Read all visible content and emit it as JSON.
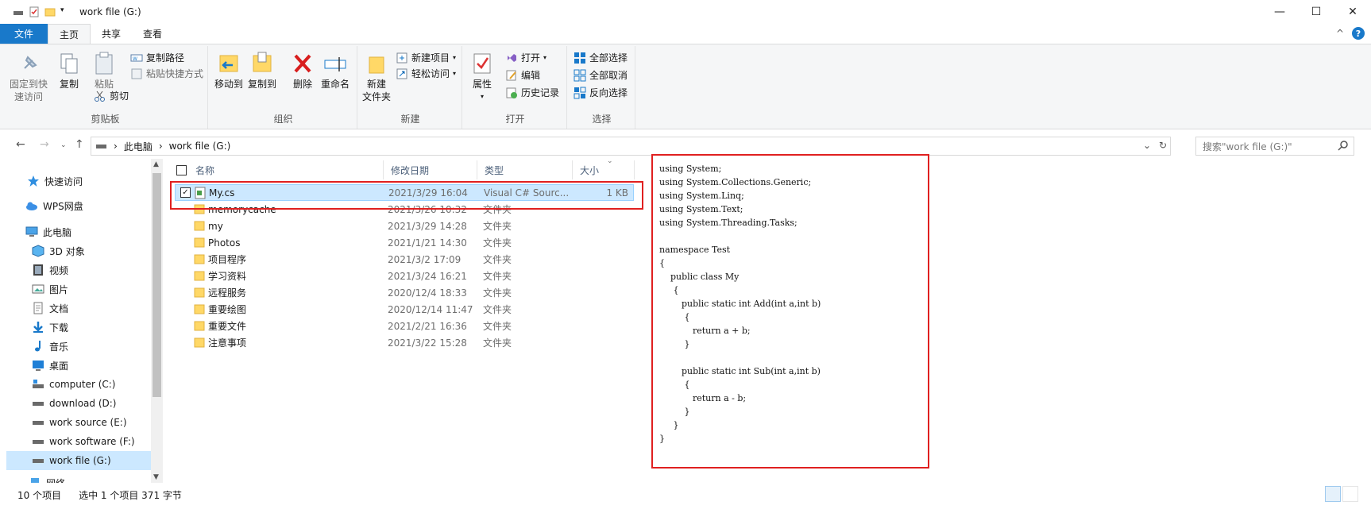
{
  "window": {
    "title": "work file (G:)"
  },
  "window_controls": {
    "minimize": "—",
    "maximize": "☐",
    "close": "✕"
  },
  "tabs": [
    {
      "label": "文件"
    },
    {
      "label": "主页"
    },
    {
      "label": "共享"
    },
    {
      "label": "查看"
    }
  ],
  "help": {
    "collapse": "^",
    "question": "?"
  },
  "ribbon": {
    "clipboard": {
      "label": "剪贴板",
      "pin_line1": "固定到快",
      "pin_line2": "速访问",
      "copy": "复制",
      "paste": "粘贴",
      "copy_path": "复制路径",
      "paste_shortcut": "粘贴快捷方式",
      "cut": "剪切"
    },
    "organize": {
      "label": "组织",
      "move_to": "移动到",
      "copy_to": "复制到",
      "delete": "删除",
      "rename": "重命名"
    },
    "new": {
      "label": "新建",
      "new_folder_line1": "新建",
      "new_folder_line2": "文件夹",
      "new_item": "新建项目",
      "easy_access": "轻松访问"
    },
    "open": {
      "label": "打开",
      "properties": "属性",
      "open": "打开",
      "edit": "编辑",
      "history": "历史记录"
    },
    "select": {
      "label": "选择",
      "select_all": "全部选择",
      "select_none": "全部取消",
      "invert": "反向选择"
    }
  },
  "address": {
    "crumbs": [
      "此电脑",
      "work file (G:)"
    ],
    "search_placeholder": "搜索\"work file (G:)\""
  },
  "nav": {
    "quick_access": "快速访问",
    "wps": "WPS网盘",
    "this_pc": "此电脑",
    "items": [
      "3D 对象",
      "视频",
      "图片",
      "文档",
      "下载",
      "音乐",
      "桌面"
    ],
    "drives": [
      "computer (C:)",
      "download (D:)",
      "work source (E:)",
      "work software (F:)",
      "work file (G:)"
    ],
    "network": "网络"
  },
  "columns": {
    "name": "名称",
    "date": "修改日期",
    "type": "类型",
    "size": "大小"
  },
  "files": [
    {
      "name": "My.cs",
      "date": "2021/3/29 16:04",
      "type": "Visual C# Sourc...",
      "size": "1 KB",
      "selected": true
    },
    {
      "name": "memorycache",
      "date": "2021/3/26 10:32",
      "type": "文件夹",
      "size": ""
    },
    {
      "name": "my",
      "date": "2021/3/29 14:28",
      "type": "文件夹",
      "size": ""
    },
    {
      "name": "Photos",
      "date": "2021/1/21 14:30",
      "type": "文件夹",
      "size": ""
    },
    {
      "name": "项目程序",
      "date": "2021/3/2 17:09",
      "type": "文件夹",
      "size": ""
    },
    {
      "name": "学习资料",
      "date": "2021/3/24 16:21",
      "type": "文件夹",
      "size": ""
    },
    {
      "name": "远程服务",
      "date": "2020/12/4 18:33",
      "type": "文件夹",
      "size": ""
    },
    {
      "name": "重要绘图",
      "date": "2020/12/14 11:47",
      "type": "文件夹",
      "size": ""
    },
    {
      "name": "重要文件",
      "date": "2021/2/21 16:36",
      "type": "文件夹",
      "size": ""
    },
    {
      "name": "注意事项",
      "date": "2021/3/22 15:28",
      "type": "文件夹",
      "size": ""
    }
  ],
  "preview": {
    "code": "using System;\nusing System.Collections.Generic;\nusing System.Linq;\nusing System.Text;\nusing System.Threading.Tasks;\n\nnamespace Test\n{\n    public class My\n     {\n        public static int Add(int a,int b)\n         {\n            return a + b;\n         }\n\n        public static int Sub(int a,int b)\n         {\n            return a - b;\n         }\n     }\n}"
  },
  "status": {
    "count": "10 个项目",
    "selected": "选中 1 个项目  371 字节"
  },
  "colors": {
    "accent": "#1979ca",
    "selection": "#cce8ff",
    "highlight": "#e02020",
    "folder": "#ffd867"
  }
}
